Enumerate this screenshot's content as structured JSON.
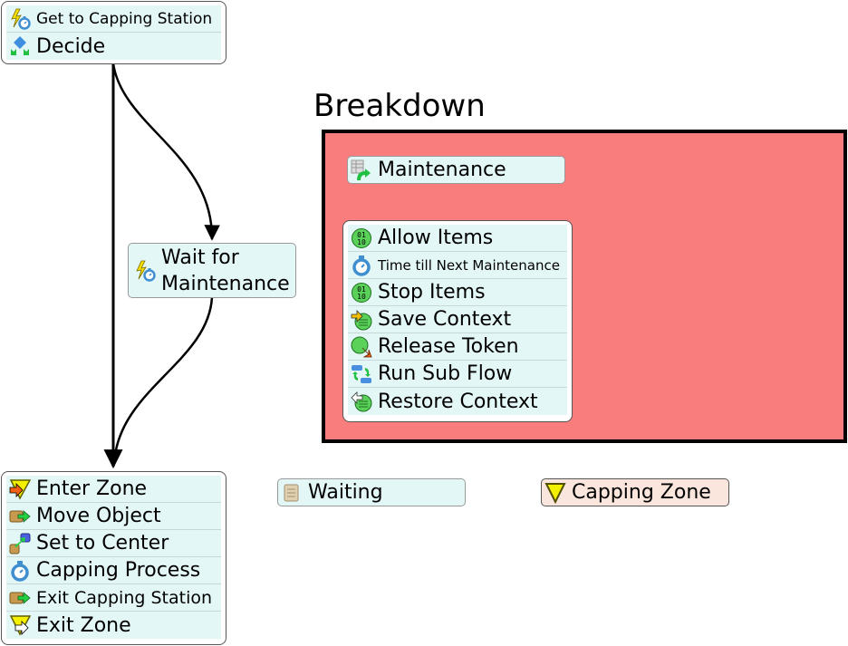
{
  "top_block": {
    "items": [
      {
        "label": "Get to Capping Station",
        "icon": "event-timer-icon"
      },
      {
        "label": "Decide",
        "icon": "decide-icon"
      }
    ]
  },
  "wait_block": {
    "line1": "Wait for",
    "line2": "Maintenance",
    "icon": "event-timer-icon"
  },
  "bottom_block": {
    "items": [
      {
        "label": "Enter Zone",
        "icon": "enter-zone-icon"
      },
      {
        "label": "Move Object",
        "icon": "move-object-icon"
      },
      {
        "label": "Set to Center",
        "icon": "set-center-icon"
      },
      {
        "label": "Capping Process",
        "icon": "delay-timer-icon"
      },
      {
        "label": "Exit Capping Station",
        "icon": "move-object-icon"
      },
      {
        "label": "Exit Zone",
        "icon": "exit-zone-icon"
      }
    ]
  },
  "breakdown": {
    "title": "Breakdown",
    "fill_color": "#fa7d7d",
    "source": {
      "label": "Maintenance",
      "icon": "schedule-source-icon"
    },
    "items": [
      {
        "label": "Allow Items",
        "icon": "binary-icon"
      },
      {
        "label": "Time till Next Maintenance",
        "icon": "delay-timer-icon"
      },
      {
        "label": "Stop Items",
        "icon": "binary-icon"
      },
      {
        "label": "Save Context",
        "icon": "save-context-icon"
      },
      {
        "label": "Release Token",
        "icon": "release-token-icon"
      },
      {
        "label": "Run Sub Flow",
        "icon": "run-subflow-icon"
      },
      {
        "label": "Restore Context",
        "icon": "restore-context-icon"
      }
    ]
  },
  "waiting": {
    "label": "Waiting",
    "icon": "list-scroll-icon"
  },
  "capping_zone": {
    "label": "Capping Zone",
    "icon": "zone-icon",
    "fill_color": "#fae6dc"
  }
}
